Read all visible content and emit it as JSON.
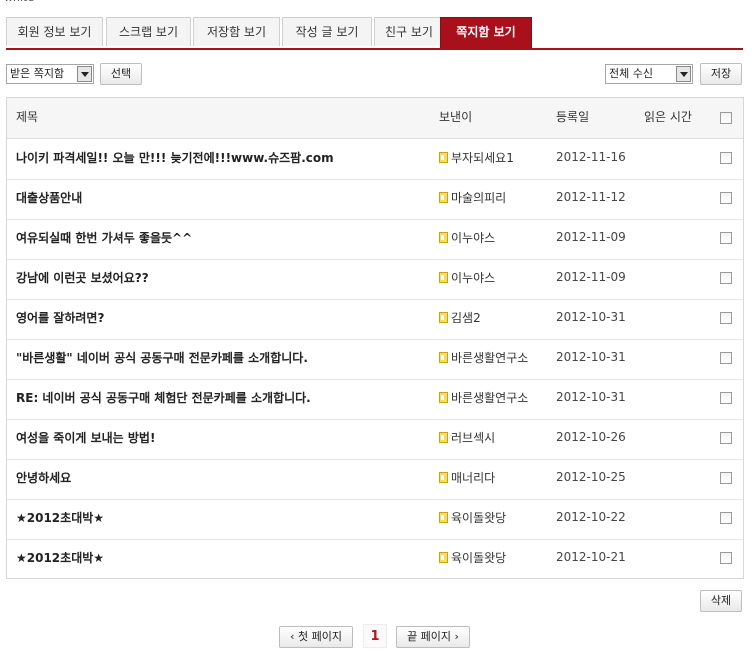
{
  "top_text": "white",
  "tabs": [
    {
      "label": "회원 정보 보기",
      "active": false
    },
    {
      "label": "스크랩 보기",
      "active": false
    },
    {
      "label": "저장함 보기",
      "active": false
    },
    {
      "label": "작성 글 보기",
      "active": false
    },
    {
      "label": "친구 보기",
      "active": false
    },
    {
      "label": "쪽지함 보기",
      "active": true
    }
  ],
  "toolbar": {
    "box_select": "받은 쪽지함",
    "select_button": "선택",
    "filter_select": "전체 수신",
    "save_button": "저장"
  },
  "table": {
    "headers": {
      "subject": "제목",
      "sender": "보낸이",
      "date": "등록일",
      "read_time": "읽은 시간"
    },
    "rows": [
      {
        "subject": "나이키 파격세일!! 오늘 만!!! 늦기전에!!!www.슈즈팜.com",
        "sender": "부자되세요1",
        "date": "2012-11-16"
      },
      {
        "subject": "대출상품안내",
        "sender": "마술의피리",
        "date": "2012-11-12"
      },
      {
        "subject": "여유되실때 한번 가셔두 좋을듯^^",
        "sender": "이누야스",
        "date": "2012-11-09"
      },
      {
        "subject": "강남에 이런곳 보셨어요??",
        "sender": "이누야스",
        "date": "2012-11-09"
      },
      {
        "subject": "영어를 잘하려면?",
        "sender": "김샘2",
        "date": "2012-10-31"
      },
      {
        "subject": "\"바른생활\" 네이버 공식 공동구매 전문카페를 소개합니다.",
        "sender": "바른생활연구소",
        "date": "2012-10-31"
      },
      {
        "subject": "RE: 네이버 공식 공동구매 체험단 전문카페를 소개합니다.",
        "sender": "바른생활연구소",
        "date": "2012-10-31"
      },
      {
        "subject": "여성을 죽이게 보내는 방법!",
        "sender": "러브섹시",
        "date": "2012-10-26"
      },
      {
        "subject": "안녕하세요",
        "sender": "매너리다",
        "date": "2012-10-25"
      },
      {
        "subject": "★2012초대박★",
        "sender": "육이돌왓당",
        "date": "2012-10-22"
      },
      {
        "subject": "★2012초대박★",
        "sender": "육이돌왓당",
        "date": "2012-10-21"
      }
    ]
  },
  "delete_button": "삭제",
  "pagination": {
    "first_label": "‹ 첫 페이지",
    "current_page": "1",
    "last_label": "끝 페이지 ›"
  },
  "colors": {
    "accent": "#a8101c"
  }
}
